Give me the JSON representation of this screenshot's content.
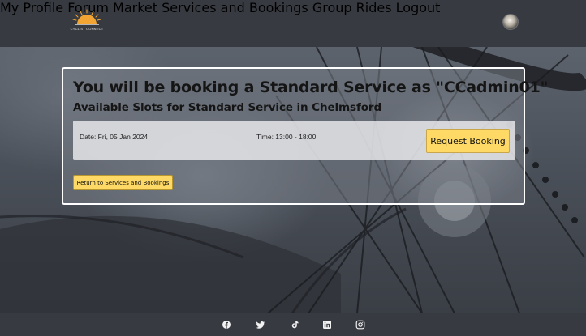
{
  "header": {
    "logo_text": "CYCLIST CONNECT",
    "logo_icon": "sunrise-logo-icon",
    "nav": [
      {
        "label": "My Profile"
      },
      {
        "label": "Forum"
      },
      {
        "label": "Market"
      },
      {
        "label": "Services and Bookings"
      },
      {
        "label": "Group Rides"
      },
      {
        "label": "Logout"
      }
    ],
    "avatar_icon": "user-avatar"
  },
  "booking": {
    "title": "You will be booking a Standard Service as \"CCadmin01\"",
    "subtitle": "Available Slots for Standard Service in Chelmsford",
    "slot": {
      "date": "Date: Fri, 05 Jan 2024",
      "time": "Time: 13:00 - 18:00",
      "button": "Request Booking"
    },
    "return_button": "Return to Services and Bookings"
  },
  "footer": {
    "social": [
      "facebook-icon",
      "twitter-icon",
      "tiktok-icon",
      "linkedin-icon",
      "instagram-icon"
    ]
  },
  "colors": {
    "header_bg": "#373a40",
    "button_yellow": "#ffd966",
    "logo_orange": "#f2a533"
  }
}
